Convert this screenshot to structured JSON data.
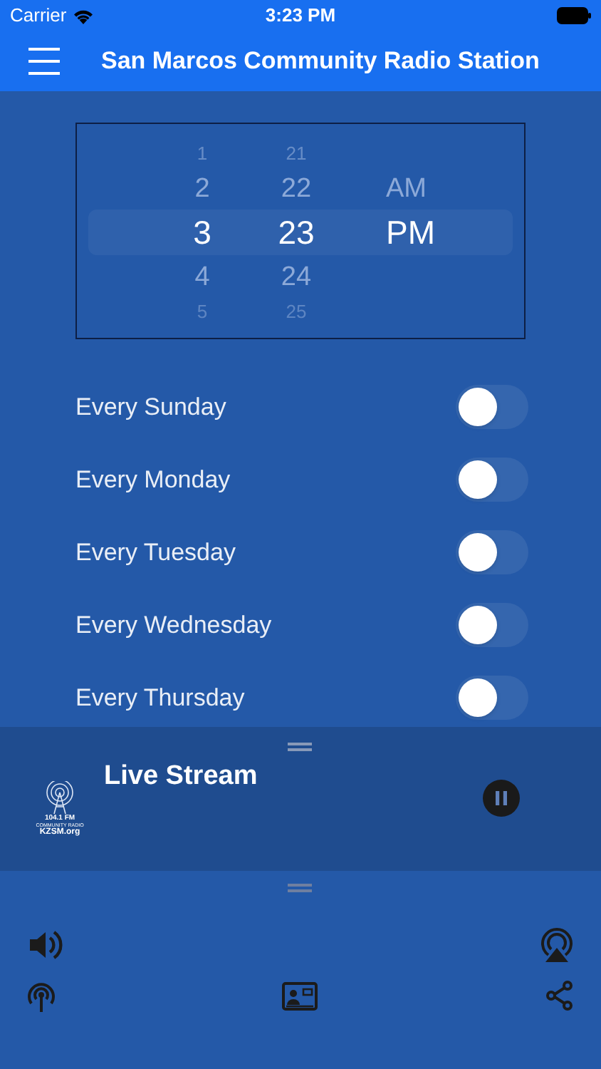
{
  "status_bar": {
    "carrier": "Carrier",
    "time": "3:23 PM"
  },
  "nav_bar": {
    "title": "San Marcos Community Radio Station"
  },
  "time_picker": {
    "columns": [
      {
        "items": [
          {
            "label": "1",
            "selected": false
          },
          {
            "label": "2",
            "selected": false
          },
          {
            "label": "3",
            "selected": true
          },
          {
            "label": "4",
            "selected": false
          },
          {
            "label": "5",
            "selected": false
          }
        ]
      },
      {
        "items": [
          {
            "label": "21",
            "selected": false
          },
          {
            "label": "22",
            "selected": false
          },
          {
            "label": "23",
            "selected": true
          },
          {
            "label": "24",
            "selected": false
          },
          {
            "label": "25",
            "selected": false
          }
        ]
      },
      {
        "items": [
          {
            "label": "AM",
            "selected": false
          },
          {
            "label": "PM",
            "selected": true
          }
        ]
      }
    ]
  },
  "days": [
    {
      "label": "Every Sunday",
      "on": false
    },
    {
      "label": "Every Monday",
      "on": false
    },
    {
      "label": "Every Tuesday",
      "on": false
    },
    {
      "label": "Every Wednesday",
      "on": false
    },
    {
      "label": "Every Thursday",
      "on": false
    }
  ],
  "mini_player": {
    "title": "Live Stream",
    "logo_lines": [
      "104.1 FM",
      "COMMUNITY RADIO",
      "KZSM.org"
    ],
    "playing": true
  }
}
